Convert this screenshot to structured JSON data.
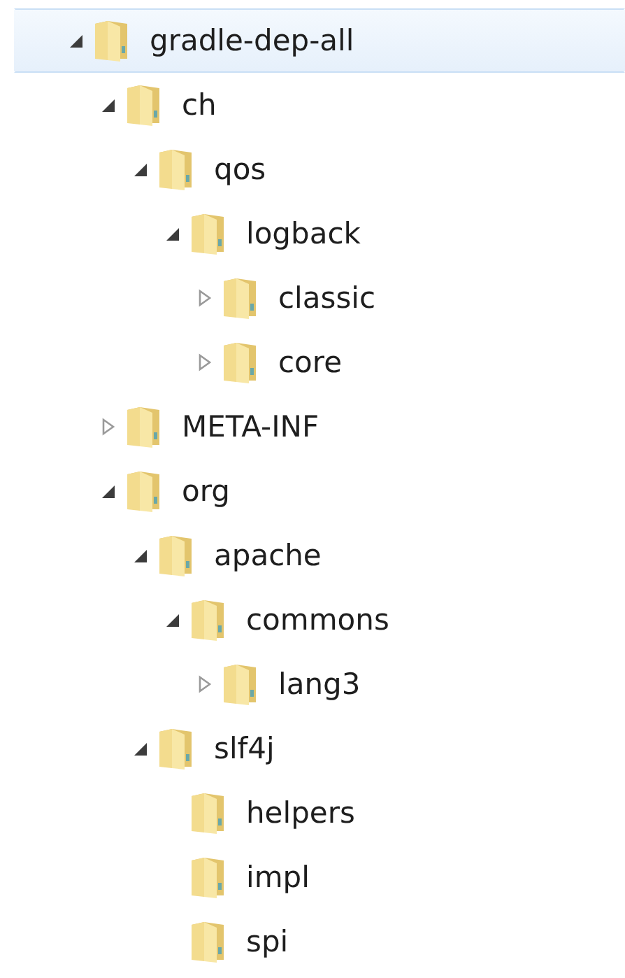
{
  "tree": [
    {
      "label": "gradle-dep-all",
      "selected": true,
      "expanded": true,
      "children": [
        {
          "label": "ch",
          "selected": false,
          "expanded": true,
          "children": [
            {
              "label": "qos",
              "selected": false,
              "expanded": true,
              "children": [
                {
                  "label": "logback",
                  "selected": false,
                  "expanded": true,
                  "children": [
                    {
                      "label": "classic",
                      "selected": false,
                      "expanded": false
                    },
                    {
                      "label": "core",
                      "selected": false,
                      "expanded": false
                    }
                  ]
                }
              ]
            }
          ]
        },
        {
          "label": "META-INF",
          "selected": false,
          "expanded": false
        },
        {
          "label": "org",
          "selected": false,
          "expanded": true,
          "children": [
            {
              "label": "apache",
              "selected": false,
              "expanded": true,
              "children": [
                {
                  "label": "commons",
                  "selected": false,
                  "expanded": true,
                  "children": [
                    {
                      "label": "lang3",
                      "selected": false,
                      "expanded": false
                    }
                  ]
                }
              ]
            },
            {
              "label": "slf4j",
              "selected": false,
              "expanded": true,
              "children": [
                {
                  "label": "helpers",
                  "selected": false
                },
                {
                  "label": "impl",
                  "selected": false
                },
                {
                  "label": "spi",
                  "selected": false
                }
              ]
            }
          ]
        }
      ]
    }
  ]
}
